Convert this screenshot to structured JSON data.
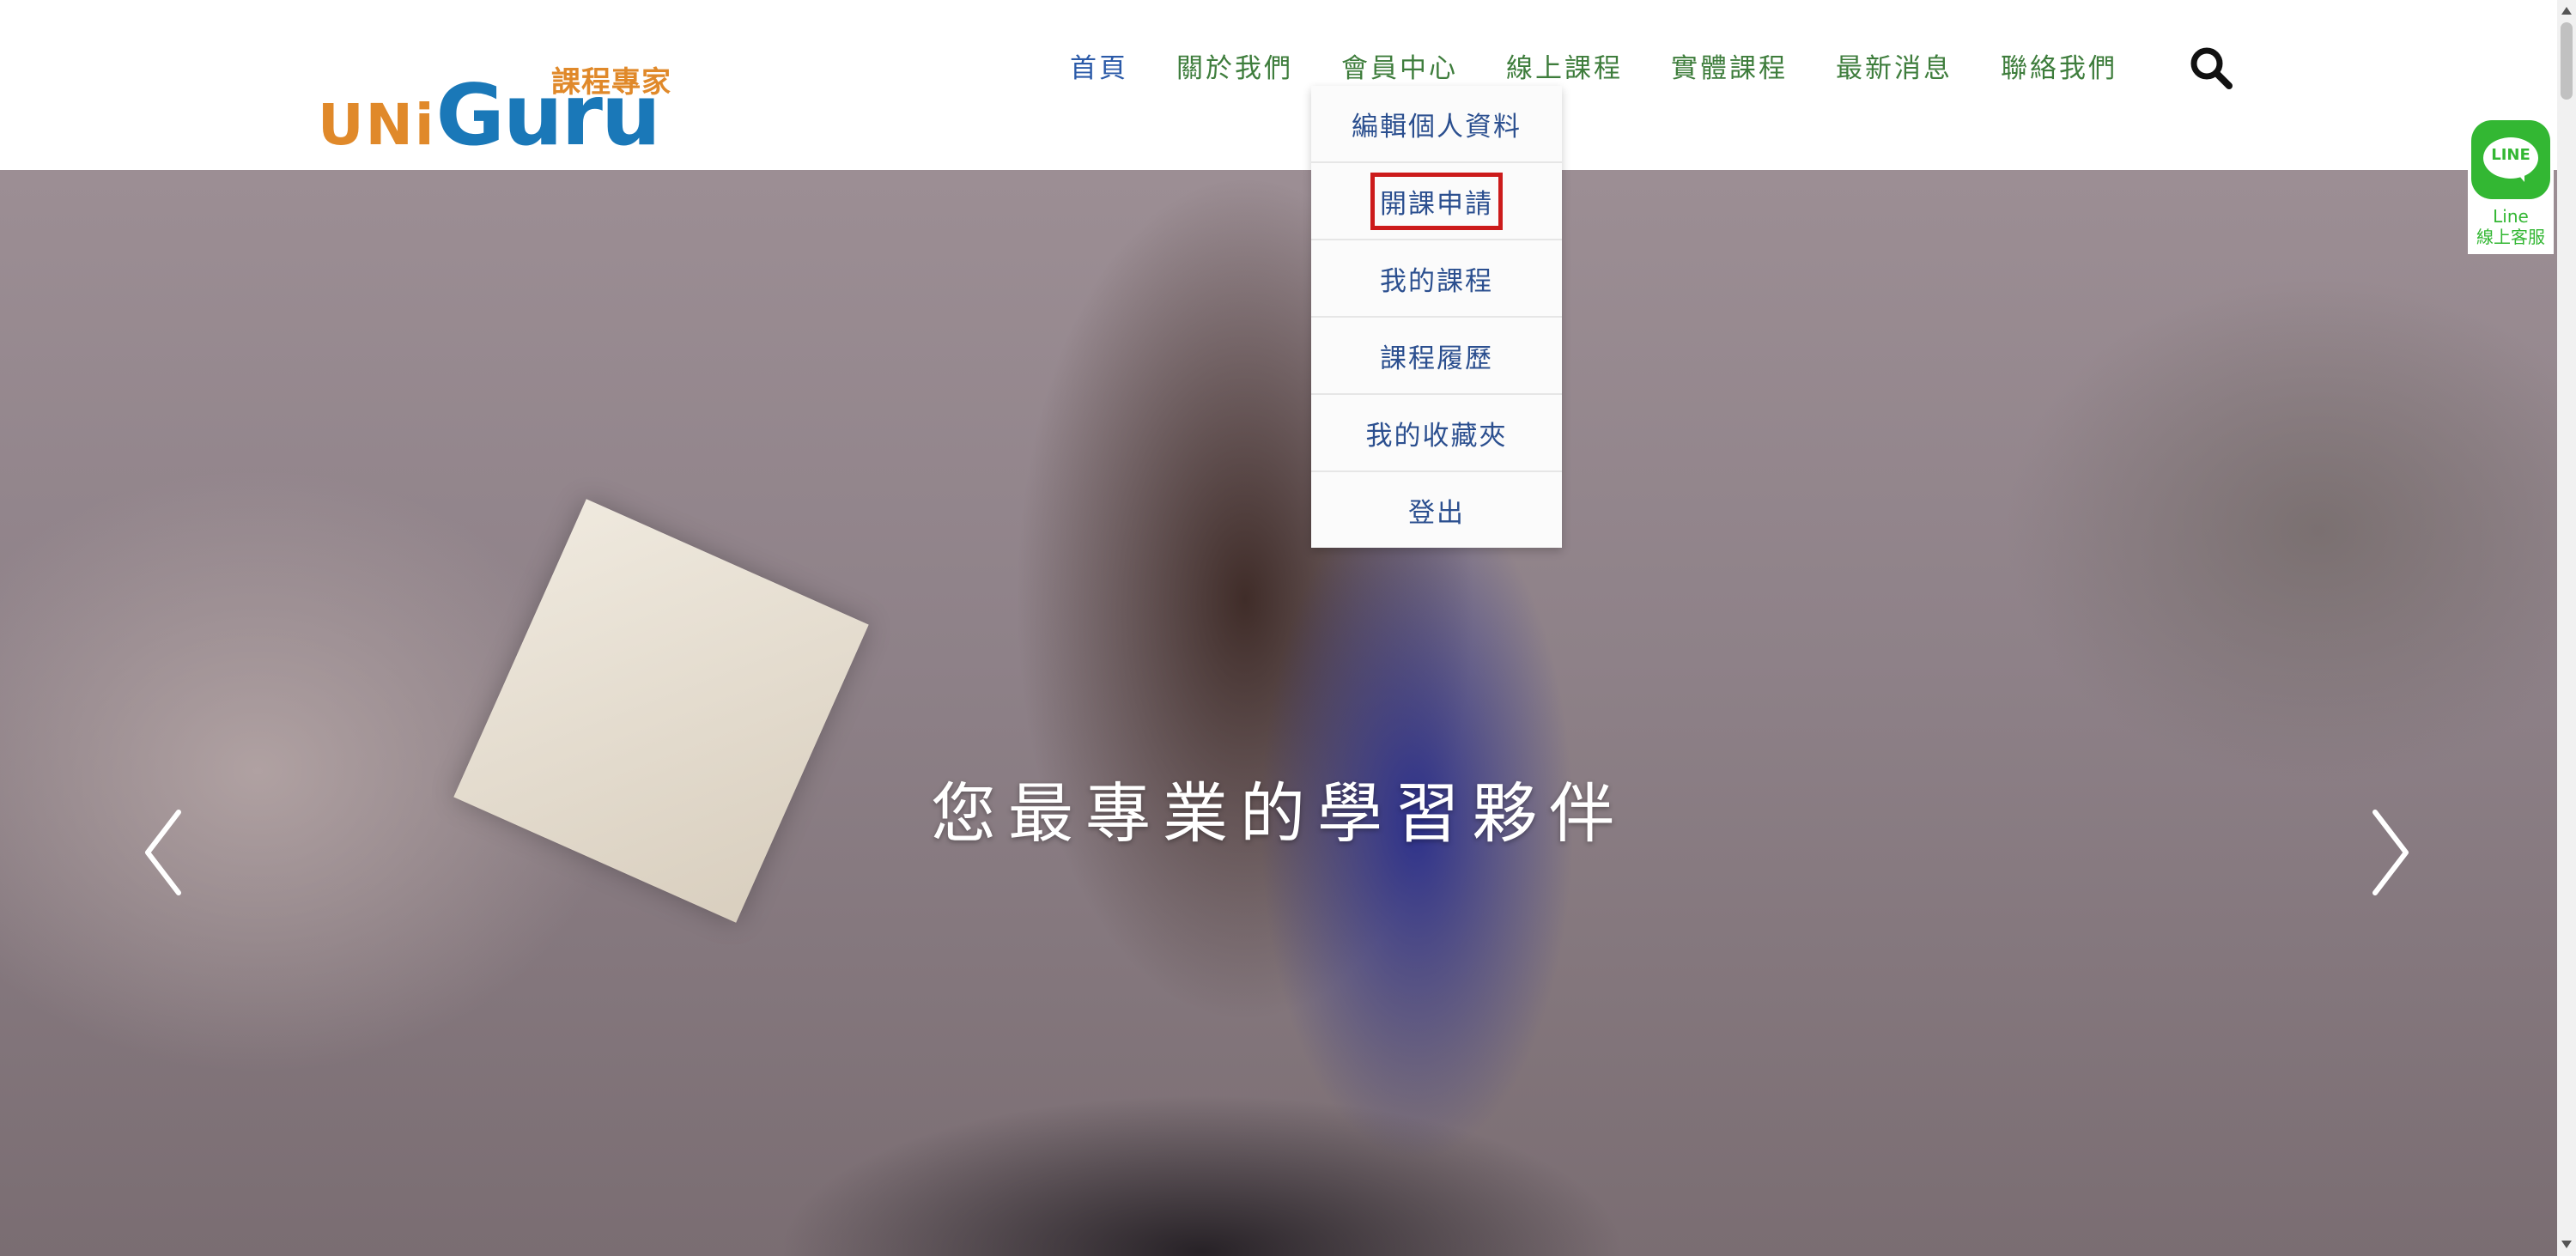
{
  "brand": {
    "tagline": "課程專家",
    "uni": "UNi",
    "guru": "Guru"
  },
  "nav": {
    "items": [
      "首頁",
      "關於我們",
      "會員中心",
      "線上課程",
      "實體課程",
      "最新消息",
      "聯絡我們"
    ]
  },
  "member_menu": {
    "items": [
      {
        "label": "編輯個人資料"
      },
      {
        "label": "開課申請",
        "highlighted": true
      },
      {
        "label": "我的課程"
      },
      {
        "label": "課程履歷"
      },
      {
        "label": "我的收藏夾"
      },
      {
        "label": "登出"
      }
    ]
  },
  "hero": {
    "title": "您最專業的學習夥伴"
  },
  "line_widget": {
    "badge": "LINE",
    "label_1": "Line",
    "label_2": "線上客服"
  },
  "colors": {
    "nav_text": "#3e7d3c",
    "nav_active": "#2b5aa8",
    "menu_text": "#2b4f8f",
    "highlight_border": "#cc1b1b",
    "line_green": "#33b733",
    "logo_orange": "#e0892a",
    "logo_blue": "#1a78b8"
  },
  "icons": {
    "search": "search-icon",
    "prev": "chevron-left-icon",
    "next": "chevron-right-icon",
    "line": "line-chat-icon"
  }
}
